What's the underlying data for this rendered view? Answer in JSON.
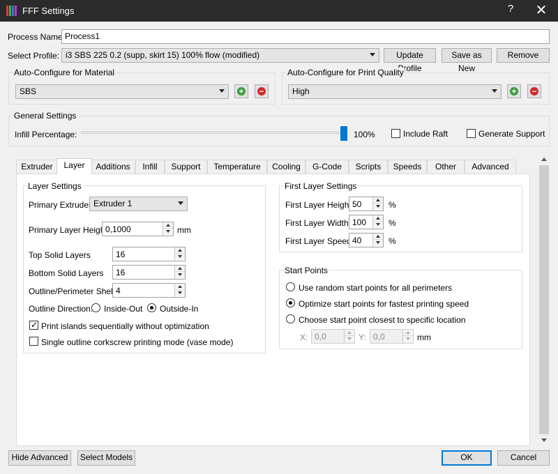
{
  "window": {
    "title": "FFF Settings",
    "help": "?",
    "close": "✕"
  },
  "process": {
    "label": "Process Name:",
    "value": "Process1"
  },
  "profile": {
    "label": "Select Profile:",
    "value": "i3 SBS 225 0.2 (supp, skirt 15) 100% flow (modified)",
    "update": "Update Profile",
    "save_as_new": "Save as New",
    "remove": "Remove"
  },
  "material": {
    "title": "Auto-Configure for Material",
    "value": "SBS"
  },
  "quality": {
    "title": "Auto-Configure for Print Quality",
    "value": "High"
  },
  "general": {
    "title": "General Settings",
    "infill_label": "Infill Percentage:",
    "infill_value": "100%",
    "infill_fraction": 1.0,
    "include_raft": "Include Raft",
    "include_raft_checked": false,
    "generate_support": "Generate Support",
    "generate_support_checked": false
  },
  "tabs": [
    {
      "label": "Extruder",
      "active": false
    },
    {
      "label": "Layer",
      "active": true
    },
    {
      "label": "Additions",
      "active": false
    },
    {
      "label": "Infill",
      "active": false
    },
    {
      "label": "Support",
      "active": false
    },
    {
      "label": "Temperature",
      "active": false
    },
    {
      "label": "Cooling",
      "active": false
    },
    {
      "label": "G-Code",
      "active": false
    },
    {
      "label": "Scripts",
      "active": false
    },
    {
      "label": "Speeds",
      "active": false
    },
    {
      "label": "Other",
      "active": false
    },
    {
      "label": "Advanced",
      "active": false
    }
  ],
  "layer_settings": {
    "title": "Layer Settings",
    "primary_extruder_label": "Primary Extruder",
    "primary_extruder_value": "Extruder 1",
    "primary_layer_height_label": "Primary Layer Height",
    "primary_layer_height_value": "0,1000",
    "primary_layer_height_unit": "mm",
    "top_solid_label": "Top Solid Layers",
    "top_solid_value": "16",
    "bottom_solid_label": "Bottom Solid Layers",
    "bottom_solid_value": "16",
    "shells_label": "Outline/Perimeter Shells",
    "shells_value": "4",
    "direction_label": "Outline Direction:",
    "inside_out": "Inside-Out",
    "outside_in": "Outside-In",
    "direction_selected": "Outside-In",
    "print_islands": "Print islands sequentially without optimization",
    "print_islands_checked": true,
    "vase_mode": "Single outline corkscrew printing mode (vase mode)",
    "vase_mode_checked": false
  },
  "first_layer": {
    "title": "First Layer Settings",
    "height_label": "First Layer Height",
    "height_value": "50",
    "width_label": "First Layer Width",
    "width_value": "100",
    "speed_label": "First Layer Speed",
    "speed_value": "40",
    "unit": "%"
  },
  "start_points": {
    "title": "Start Points",
    "random": "Use random start points for all perimeters",
    "optimize": "Optimize start points for fastest printing speed",
    "closest": "Choose start point closest to specific location",
    "selected": "optimize",
    "x_label": "X:",
    "x_value": "0,0",
    "y_label": "Y:",
    "y_value": "0,0",
    "unit": "mm"
  },
  "footer": {
    "hide_advanced": "Hide Advanced",
    "select_models": "Select Models",
    "ok": "OK",
    "cancel": "Cancel"
  },
  "colors": {
    "accent": "#0078d7",
    "titlebar": "#2b2b2b",
    "add": "#3c9b3c",
    "remove": "#d12a2a"
  }
}
